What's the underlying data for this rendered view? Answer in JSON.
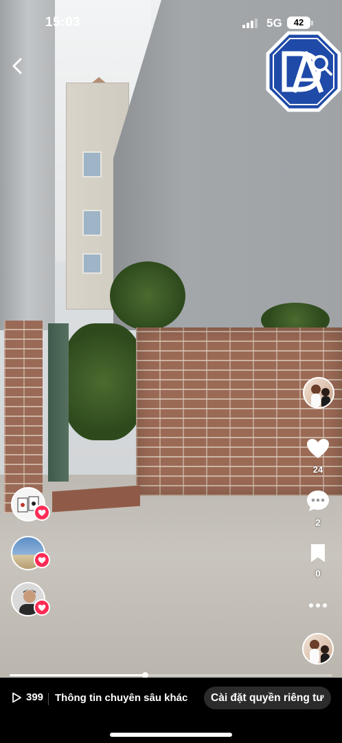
{
  "status_bar": {
    "time": "15:03",
    "network": "5G",
    "battery": "42"
  },
  "logo": {
    "letters": "DA",
    "colors": {
      "blue": "#1f4aa8",
      "outline": "#ffffff"
    }
  },
  "right_rail": {
    "likes": "24",
    "comments": "2",
    "saves": "0"
  },
  "progress": {
    "fraction": 0.42
  },
  "bottom_bar": {
    "views": "399",
    "more_info": "Thông tin chuyên sâu khác",
    "privacy_button": "Cài đặt quyền riêng tư"
  },
  "colors": {
    "like_red": "#fe2c55",
    "bar_bg": "#000000",
    "pill_bg": "#2b2b2b"
  }
}
